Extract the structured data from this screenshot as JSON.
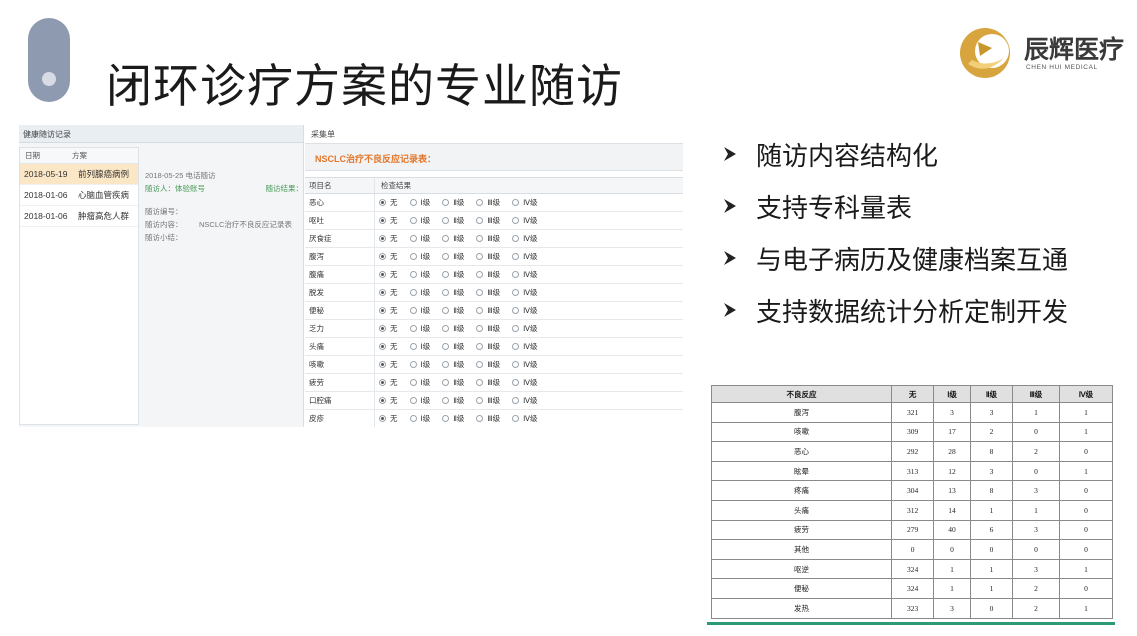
{
  "slide": {
    "title": "闭环诊疗方案的专业随访"
  },
  "logo": {
    "name_cn": "辰辉医疗",
    "name_en": "CHEN HUI MEDICAL"
  },
  "screenshot": {
    "left_header": "健康随访记录",
    "list_columns": [
      "日期",
      "方案"
    ],
    "list_rows": [
      {
        "date": "2018-05-19",
        "plan": "前列腺癌病例",
        "selected": true
      },
      {
        "date": "2018-01-06",
        "plan": "心脑血管疾病",
        "selected": false
      },
      {
        "date": "2018-01-06",
        "plan": "肿瘤高危人群",
        "selected": false
      }
    ],
    "detail": {
      "header": "2018-05-25  电话随访",
      "person": "随访人：体验账号",
      "result": "随访结果：",
      "number": "随访编号：",
      "content_label": "随访内容：",
      "content_value": "NSCLC治疗不良反应记录表",
      "summary": "随访小结："
    },
    "collect_title": "采集单",
    "form_title": "NSCLC治疗不良反应记录表：",
    "grid_headers": [
      "项目名",
      "检查结果"
    ],
    "grade_options": [
      "无",
      "Ⅰ级",
      "Ⅱ级",
      "Ⅲ级",
      "Ⅳ级"
    ],
    "grid_items": [
      "恶心",
      "呕吐",
      "厌食症",
      "腹泻",
      "腹痛",
      "脱发",
      "便秘",
      "乏力",
      "头痛",
      "咳嗽",
      "疲劳",
      "口腔痛",
      "皮疹"
    ]
  },
  "bullets": [
    "随访内容结构化",
    "支持专科量表",
    "与电子病历及健康档案互通",
    "支持数据统计分析定制开发"
  ],
  "stats_table": {
    "headers": [
      "不良反应",
      "无",
      "Ⅰ级",
      "Ⅱ级",
      "Ⅲ级",
      "Ⅳ级"
    ],
    "rows": [
      [
        "腹泻",
        "321",
        "3",
        "3",
        "1",
        "1"
      ],
      [
        "咳嗽",
        "309",
        "17",
        "2",
        "0",
        "1"
      ],
      [
        "恶心",
        "292",
        "28",
        "8",
        "2",
        "0"
      ],
      [
        "眩晕",
        "313",
        "12",
        "3",
        "0",
        "1"
      ],
      [
        "疼痛",
        "304",
        "13",
        "8",
        "3",
        "0"
      ],
      [
        "头痛",
        "312",
        "14",
        "1",
        "1",
        "0"
      ],
      [
        "疲劳",
        "279",
        "40",
        "6",
        "3",
        "0"
      ],
      [
        "其他",
        "0",
        "0",
        "0",
        "0",
        "0"
      ],
      [
        "呕逆",
        "324",
        "1",
        "1",
        "3",
        "1"
      ],
      [
        "便秘",
        "324",
        "1",
        "1",
        "2",
        "0"
      ],
      [
        "发热",
        "323",
        "3",
        "0",
        "2",
        "1"
      ]
    ]
  },
  "colors": {
    "accent_orange": "#e4772a",
    "logo_gold": "#c9962e",
    "table_underline": "#2e9a73",
    "pill": "#8d9aaf"
  }
}
